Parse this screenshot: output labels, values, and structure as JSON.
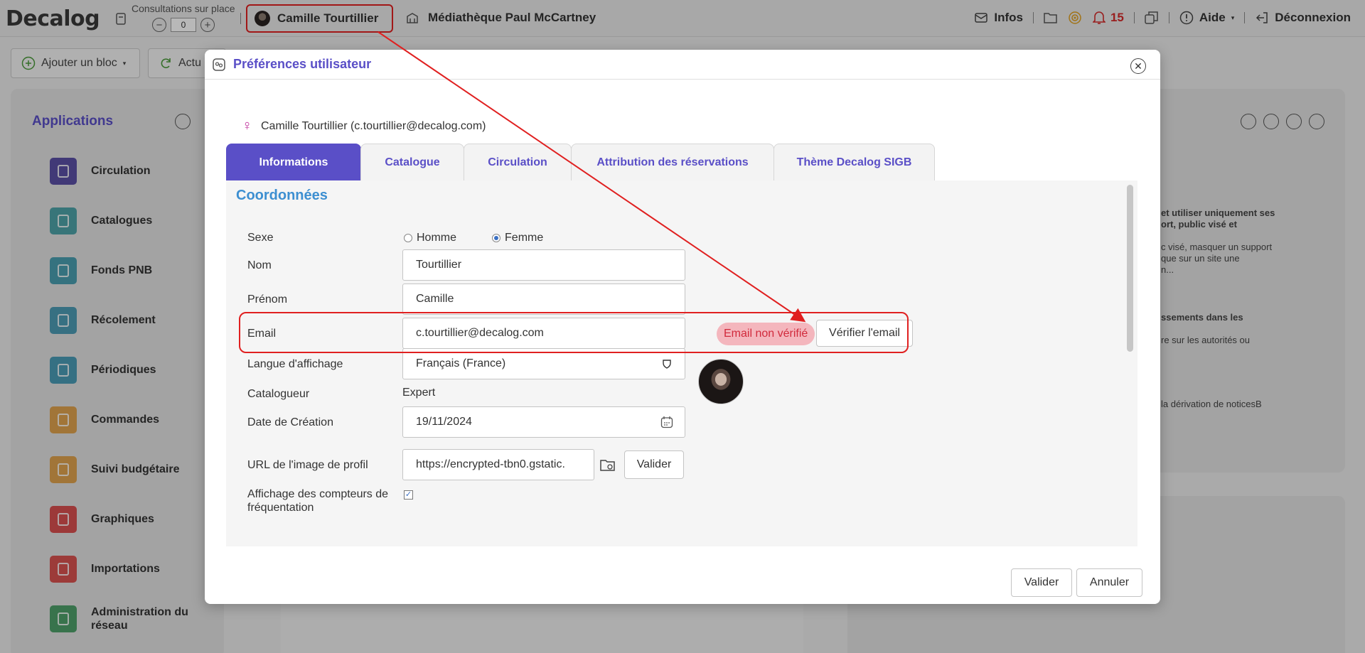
{
  "topbar": {
    "logo": "Decalog",
    "consultations_label": "Consultations sur place",
    "consultations_value": "0",
    "minus_label": "−",
    "plus_label": "+",
    "user_name": "Camille Tourtillier",
    "library_name": "Médiathèque Paul McCartney",
    "infos_label": "Infos",
    "notification_count": "15",
    "help_label": "Aide",
    "logout_label": "Déconnexion"
  },
  "background": {
    "add_block_label": "Ajouter un bloc",
    "refresh_label": "Actu",
    "applications_title": "Applications",
    "apps": [
      {
        "label": "Circulation",
        "color": "#5a4fa5"
      },
      {
        "label": "Catalogues",
        "color": "#4ea3a8"
      },
      {
        "label": "Fonds PNB",
        "color": "#4a9fb0"
      },
      {
        "label": "Récolement",
        "color": "#4d9cb5"
      },
      {
        "label": "Périodiques",
        "color": "#4a9cb6"
      },
      {
        "label": "Commandes",
        "color": "#e0a24e"
      },
      {
        "label": "Suivi budgétaire",
        "color": "#e0a24e"
      },
      {
        "label": "Graphiques",
        "color": "#d94f4f"
      },
      {
        "label": "Importations",
        "color": "#d9534f"
      },
      {
        "label": "Administration du réseau",
        "color": "#4ea06a"
      }
    ],
    "right_texts": [
      "et utiliser uniquement ses",
      "ort, public visé et",
      "c visé, masquer un support",
      "que sur un site une",
      "n...",
      "ssements dans les",
      "re sur les autorités ou",
      "la dérivation de noticesB"
    ]
  },
  "modal": {
    "title": "Préférences utilisateur",
    "user_line": "Camille Tourtillier (c.tourtillier@decalog.com)",
    "tabs": [
      {
        "label": "Informations",
        "active": true
      },
      {
        "label": "Catalogue",
        "active": false
      },
      {
        "label": "Circulation",
        "active": false
      },
      {
        "label": "Attribution des réservations",
        "active": false
      },
      {
        "label": "Thème Decalog SIGB",
        "active": false
      }
    ],
    "section_title": "Coordonnées",
    "fields": {
      "sexe_label": "Sexe",
      "sexe_options": [
        "Homme",
        "Femme"
      ],
      "sexe_selected": "Femme",
      "nom_label": "Nom",
      "nom_value": "Tourtillier",
      "prenom_label": "Prénom",
      "prenom_value": "Camille",
      "email_label": "Email",
      "email_value": "c.tourtillier@decalog.com",
      "email_status": "Email non vérifié",
      "verify_email_label": "Vérifier l'email",
      "langue_label": "Langue d'affichage",
      "langue_value": "Français (France)",
      "catalogueur_label": "Catalogueur",
      "catalogueur_value": "Expert",
      "date_label": "Date de Création",
      "date_value": "19/11/2024",
      "url_label": "URL de l'image de profil",
      "url_value": "https://encrypted-tbn0.gstatic.",
      "url_validate_label": "Valider",
      "compteurs_label": "Affichage des compteurs de fréquentation",
      "compteurs_checked": true
    },
    "footer": {
      "validate_label": "Valider",
      "cancel_label": "Annuler"
    }
  },
  "colors": {
    "accent": "#5a4fc7",
    "section": "#3d8fd1",
    "annotation": "#e02020",
    "badge_bg": "#f4b6bd",
    "badge_text": "#d12a3c"
  }
}
